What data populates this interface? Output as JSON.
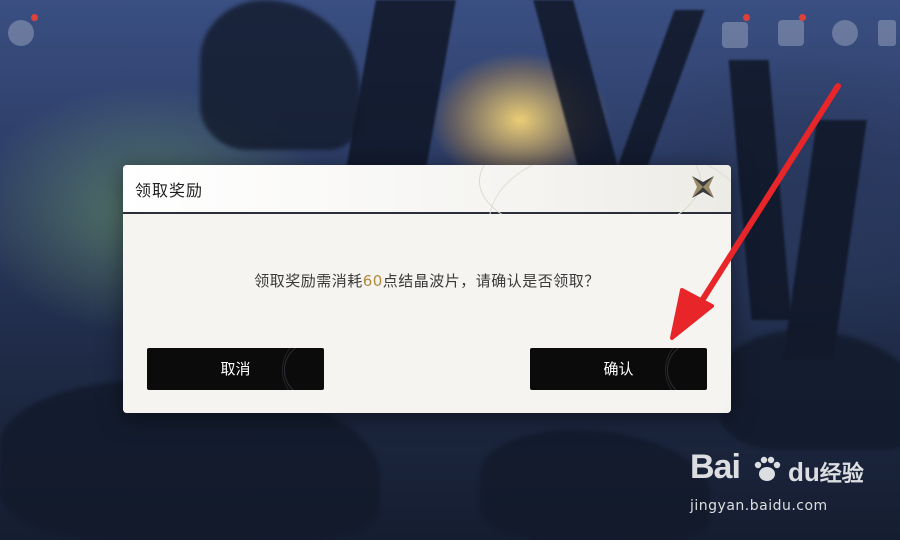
{
  "dialog": {
    "title": "领取奖励",
    "message_before": "领取奖励需消耗",
    "cost_value": "60",
    "message_after": "点结晶波片，请确认是否领取？",
    "cancel_label": "取消",
    "confirm_label": "确认"
  },
  "icons": {
    "close": "close-x-icon",
    "hud_left": "gear-icon",
    "hud_right": [
      "share-icon",
      "quest-icon",
      "settings-icon",
      "notes-icon"
    ]
  },
  "colors": {
    "highlight": "#b08a3e",
    "button_bg": "#0b0b0c",
    "annotation_arrow": "#e8262a"
  },
  "watermark": {
    "brand_left": "Bai",
    "brand_right": "du",
    "brand_cn": "经验",
    "url": "jingyan.baidu.com"
  }
}
